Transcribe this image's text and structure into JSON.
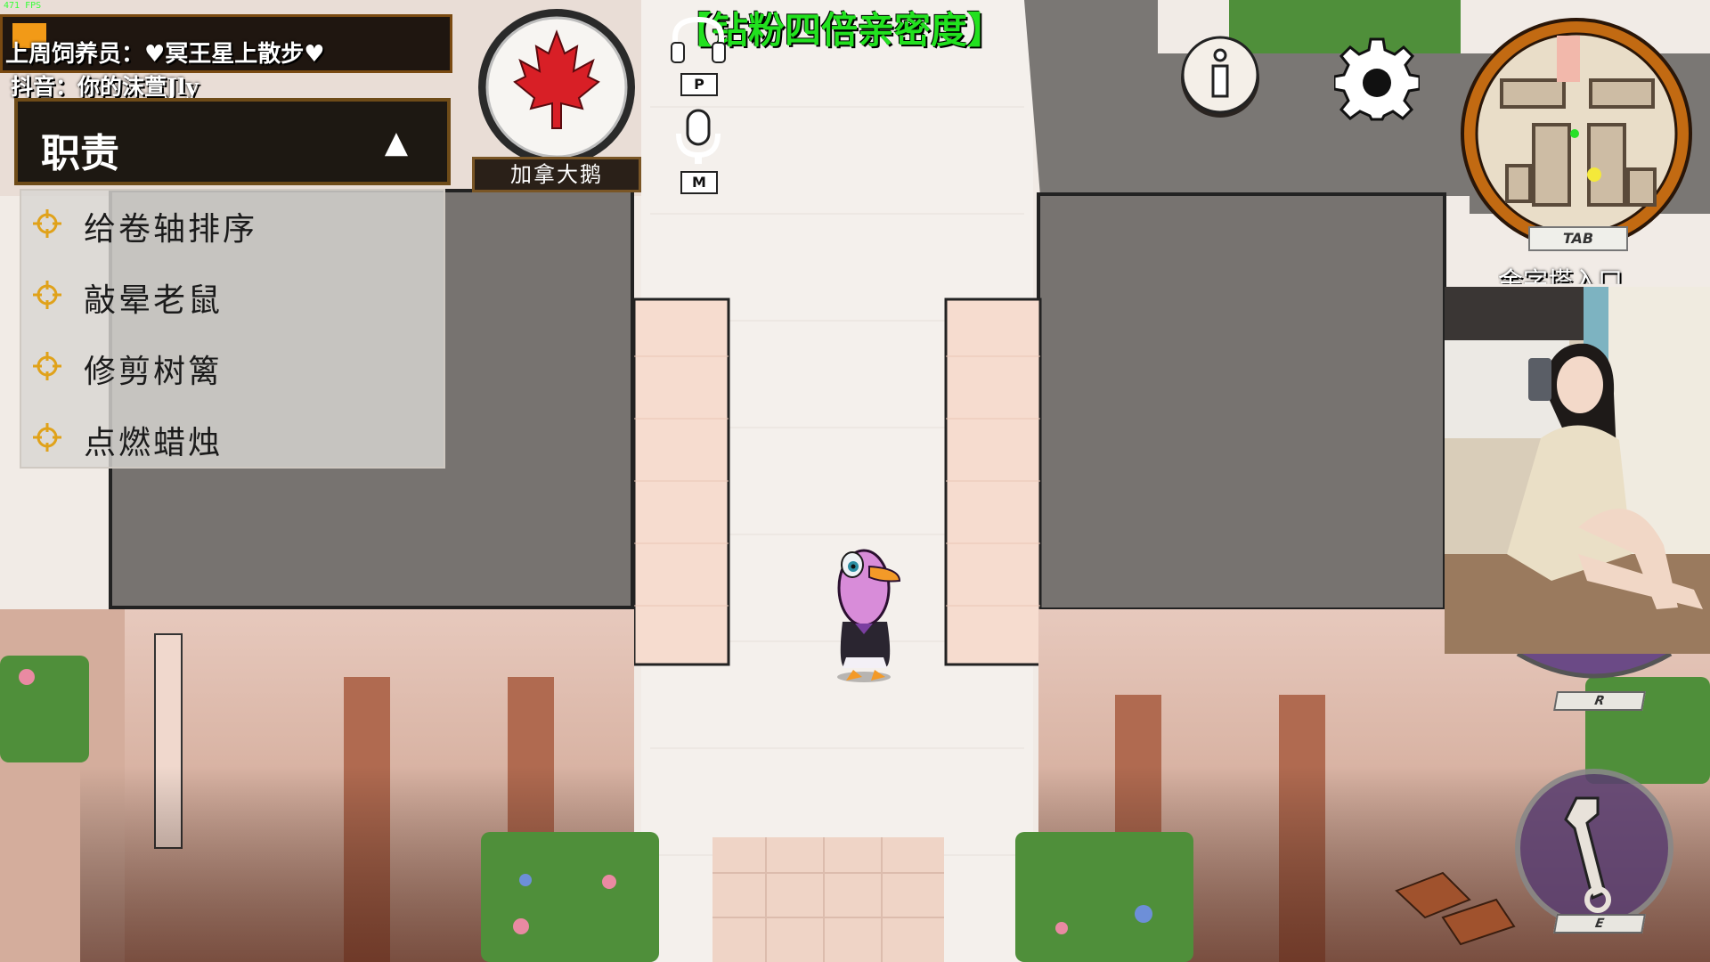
{
  "overlay": {
    "fps": "471 FPS",
    "feeder": "上周饲养员：♥冥王星上散步♥",
    "douyin": "抖音：你的沫萱Jly",
    "banner": "【钻粉四倍亲密度】"
  },
  "tasks": {
    "title": "职责",
    "toggle": "▲",
    "items": [
      {
        "label": "给卷轴排序"
      },
      {
        "label": "敲晕老鼠"
      },
      {
        "label": "修剪树篱"
      },
      {
        "label": "点燃蜡烛"
      }
    ]
  },
  "role": {
    "name": "加拿大鹅",
    "icon": "maple-leaf-icon"
  },
  "voice": {
    "push_to_talk_key": "P",
    "mute_key": "M"
  },
  "hud": {
    "info_icon": "info-icon",
    "settings_icon": "gear-icon",
    "map_key": "TAB",
    "location": "金字塔入口",
    "report_key": "R",
    "use_key": "E"
  },
  "colors": {
    "banner": "#22e11f",
    "panel_border": "#6e4b18",
    "minimap_ring": "#c26a12"
  }
}
